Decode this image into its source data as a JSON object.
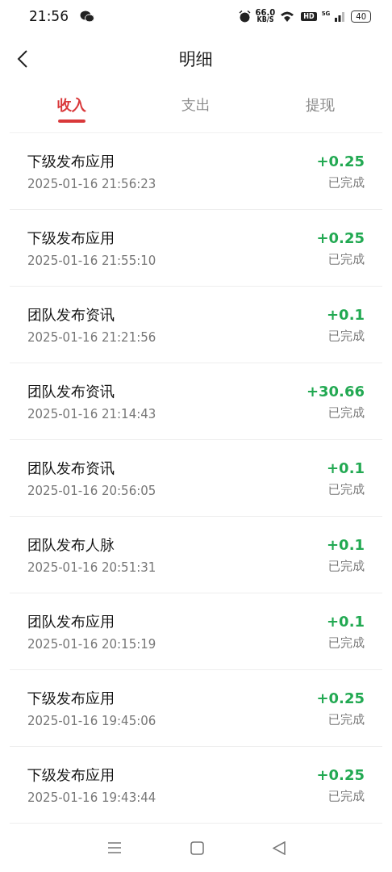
{
  "status_bar": {
    "time": "21:56",
    "net_speed": "66.0",
    "net_unit": "KB/S",
    "hd": "HD",
    "signal_type": "5G",
    "battery": "40"
  },
  "header": {
    "title": "明细"
  },
  "tabs": [
    {
      "label": "收入",
      "selected": true
    },
    {
      "label": "支出",
      "selected": false
    },
    {
      "label": "提现",
      "selected": false
    }
  ],
  "records": [
    {
      "title": "下级发布应用",
      "time": "2025-01-16 21:56:23",
      "amount": "+0.25",
      "status": "已完成"
    },
    {
      "title": "下级发布应用",
      "time": "2025-01-16 21:55:10",
      "amount": "+0.25",
      "status": "已完成"
    },
    {
      "title": "团队发布资讯",
      "time": "2025-01-16 21:21:56",
      "amount": "+0.1",
      "status": "已完成"
    },
    {
      "title": "团队发布资讯",
      "time": "2025-01-16 21:14:43",
      "amount": "+30.66",
      "status": "已完成"
    },
    {
      "title": "团队发布资讯",
      "time": "2025-01-16 20:56:05",
      "amount": "+0.1",
      "status": "已完成"
    },
    {
      "title": "团队发布人脉",
      "time": "2025-01-16 20:51:31",
      "amount": "+0.1",
      "status": "已完成"
    },
    {
      "title": "团队发布应用",
      "time": "2025-01-16 20:15:19",
      "amount": "+0.1",
      "status": "已完成"
    },
    {
      "title": "下级发布应用",
      "time": "2025-01-16 19:45:06",
      "amount": "+0.25",
      "status": "已完成"
    },
    {
      "title": "下级发布应用",
      "time": "2025-01-16 19:43:44",
      "amount": "+0.25",
      "status": "已完成"
    }
  ]
}
